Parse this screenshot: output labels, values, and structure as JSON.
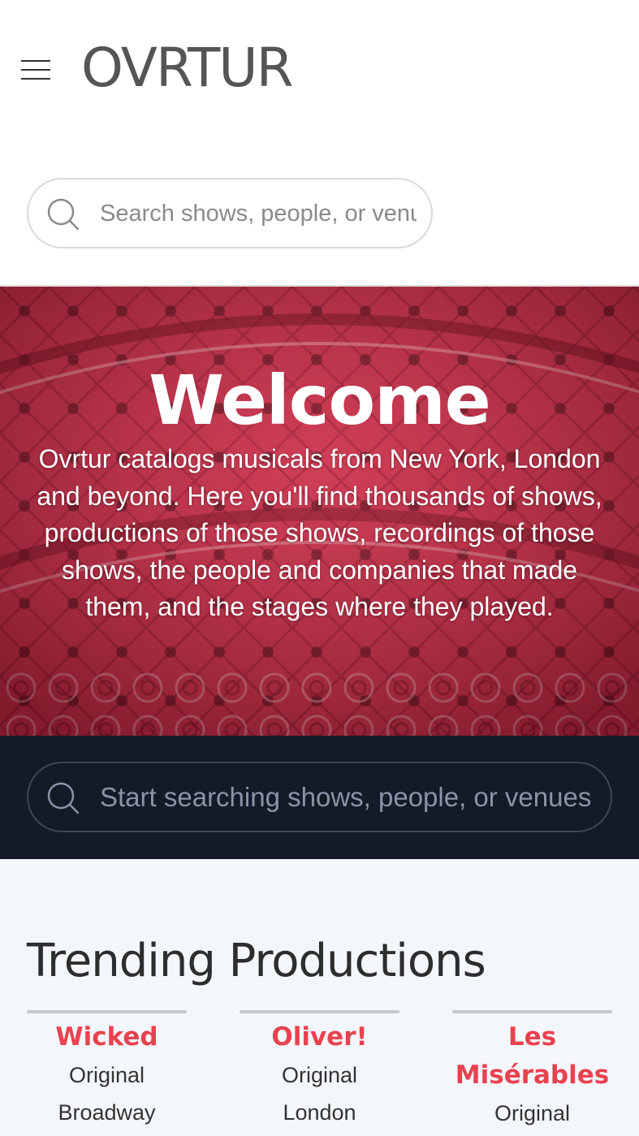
{
  "header": {
    "logo": "OVRTUR",
    "menu_icon": "hamburger-menu-icon"
  },
  "search_top": {
    "placeholder": "Search shows, people, or venues",
    "icon": "search-icon"
  },
  "hero": {
    "title": "Welcome",
    "text": "Ovrtur catalogs musicals from New York, London and beyond. Here you'll find thousands of shows, productions of those shows, recordings of those shows, the people and companies that made them, and the stages where they played.",
    "tint_color": "#c8324c"
  },
  "search_band": {
    "placeholder": "Start searching shows, people, or venues",
    "icon": "search-icon",
    "background": "#141a26"
  },
  "trending": {
    "title": "Trending Productions",
    "accent": "#e8424f",
    "items": [
      {
        "name": "Wicked",
        "line1": "Original",
        "line2": "Broadway"
      },
      {
        "name": "Oliver!",
        "line1": "Original",
        "line2": "London"
      },
      {
        "name": "Les Misérables",
        "line1": "Original"
      }
    ]
  }
}
